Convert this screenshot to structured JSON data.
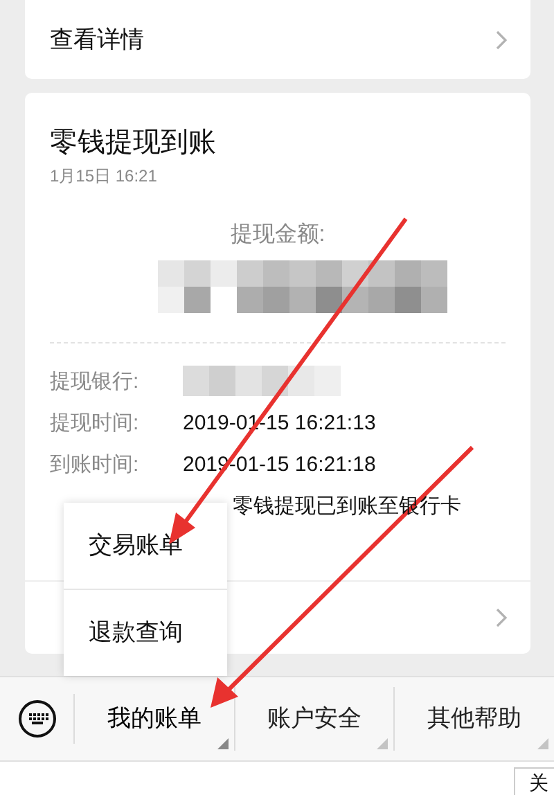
{
  "top_card": {
    "link": "查看详情"
  },
  "notice": {
    "title": "零钱提现到账",
    "time": "1月15日  16:21",
    "amount_label": "提现金额:",
    "rows": [
      {
        "label": "提现银行:",
        "kind": "redacted"
      },
      {
        "label": "提现时间:",
        "kind": "text",
        "value": "2019-01-15 16:21:13"
      },
      {
        "label": "到账时间:",
        "kind": "text",
        "value": "2019-01-15 16:21:18"
      },
      {
        "kind": "note",
        "value": "零钱提现已到账至银行卡"
      }
    ]
  },
  "popup_menu": [
    "交易账单",
    "退款查询"
  ],
  "menu_bar": [
    {
      "label": "我的账单",
      "expanded": true
    },
    {
      "label": "账户安全",
      "expanded": false
    },
    {
      "label": "其他帮助",
      "expanded": false
    }
  ],
  "bottom_button": "关"
}
